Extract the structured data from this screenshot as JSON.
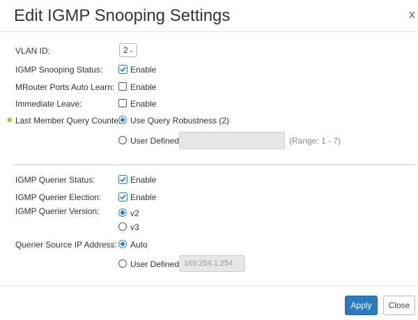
{
  "dialog": {
    "title": "Edit IGMP Snooping Settings",
    "close_glyph": "X"
  },
  "vlan": {
    "label": "VLAN ID:",
    "value": "2"
  },
  "snooping_status": {
    "label": "IGMP Snooping Status:",
    "option": "Enable",
    "checked": true
  },
  "mrouter": {
    "label": "MRouter Ports Auto Learn:",
    "option": "Enable",
    "checked": false
  },
  "immediate_leave": {
    "label": "Immediate Leave:",
    "option": "Enable",
    "checked": false
  },
  "last_member": {
    "label": "Last Member Query Counter:",
    "opt_robustness": "Use Query Robustness (2)",
    "opt_user": "User Defined",
    "user_value": "",
    "range": "(Range: 1 - 7)",
    "selected": "robustness"
  },
  "querier_status": {
    "label": "IGMP Querier Status:",
    "option": "Enable",
    "checked": true
  },
  "querier_election": {
    "label": "IGMP Querier Election:",
    "option": "Enable",
    "checked": true
  },
  "querier_version": {
    "label": "IGMP Querier Version:",
    "opt_v2": "v2",
    "opt_v3": "v3",
    "selected": "v2"
  },
  "querier_source": {
    "label": "Querier Source IP Address:",
    "opt_auto": "Auto",
    "opt_user": "User Defined",
    "placeholder": "169.254.1.254",
    "selected": "auto"
  },
  "footer": {
    "apply_label": "Apply",
    "close_label": "Close"
  },
  "colors": {
    "accent": "#2a7bc0",
    "required_marker": "#e8a317"
  },
  "icons": {
    "checkbox_checked": "check-icon",
    "select_arrow": "chevron-down-icon",
    "required": "asterisk-icon"
  }
}
